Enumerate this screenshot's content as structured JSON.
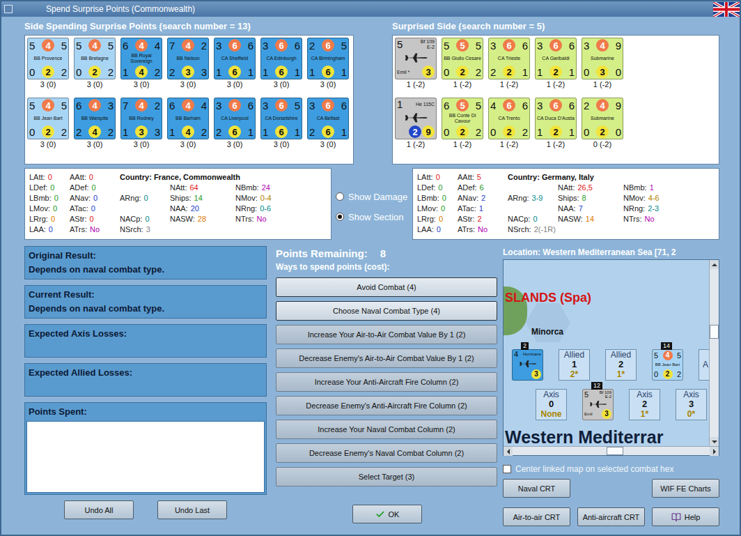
{
  "window": {
    "title": "Spend Surprise Points (Commonwealth)"
  },
  "spending_side": {
    "title": "Side Spending Surprise Points (search number = 13)",
    "rows": [
      [
        {
          "kind": "ship",
          "name": "BB Provence",
          "top": [
            "5",
            "4",
            "5"
          ],
          "bottom": [
            "0",
            "2",
            "2"
          ],
          "footer": "3 (0)",
          "color": "#a9d5f5"
        },
        {
          "kind": "ship",
          "name": "BB Bretagne",
          "top": [
            "5",
            "4",
            "5"
          ],
          "bottom": [
            "0",
            "2",
            "2"
          ],
          "footer": "3 (0)",
          "color": "#a9d5f5"
        },
        {
          "kind": "ship",
          "name": "BB Royal Sovereign",
          "top": [
            "6",
            "4",
            "4"
          ],
          "bottom": [
            "1",
            "4",
            "2"
          ],
          "footer": "3 (0)",
          "color": "#3d9de0"
        },
        {
          "kind": "ship",
          "name": "BB Nelson",
          "top": [
            "7",
            "4",
            "2"
          ],
          "bottom": [
            "2",
            "3",
            "3"
          ],
          "footer": "3 (0)",
          "color": "#3d9de0"
        },
        {
          "kind": "ship",
          "name": "CA Sheffield",
          "top": [
            "3",
            "6",
            "6"
          ],
          "bottom": [
            "1",
            "6",
            "1"
          ],
          "footer": "3 (0)",
          "color": "#3d9de0"
        },
        {
          "kind": "ship",
          "name": "CA Edinburgh",
          "top": [
            "3",
            "6",
            "6"
          ],
          "bottom": [
            "1",
            "6",
            "1"
          ],
          "footer": "3 (0)",
          "color": "#3d9de0"
        },
        {
          "kind": "ship",
          "name": "CA Birmingham",
          "top": [
            "2",
            "6",
            "5"
          ],
          "bottom": [
            "1",
            "6",
            "1"
          ],
          "footer": "3 (0)",
          "color": "#3d9de0"
        }
      ],
      [
        {
          "kind": "ship",
          "name": "BB Jean Bart",
          "top": [
            "5",
            "4",
            "5"
          ],
          "bottom": [
            "0",
            "2",
            "2"
          ],
          "footer": "3 (0)",
          "color": "#a9d5f5"
        },
        {
          "kind": "ship",
          "name": "BB Warspite",
          "top": [
            "6",
            "4",
            "3"
          ],
          "bottom": [
            "2",
            "4",
            "2"
          ],
          "footer": "3 (0)",
          "color": "#3d9de0"
        },
        {
          "kind": "ship",
          "name": "BB Rodney",
          "top": [
            "7",
            "4",
            "2"
          ],
          "bottom": [
            "1",
            "3",
            "3"
          ],
          "footer": "3 (0)",
          "color": "#3d9de0"
        },
        {
          "kind": "ship",
          "name": "BB Barham",
          "top": [
            "6",
            "4",
            "4"
          ],
          "bottom": [
            "1",
            "4",
            "2"
          ],
          "footer": "3 (0)",
          "color": "#3d9de0"
        },
        {
          "kind": "ship",
          "name": "CA Liverpool",
          "top": [
            "3",
            "6",
            "6"
          ],
          "bottom": [
            "2",
            "6",
            "1"
          ],
          "footer": "3 (0)",
          "color": "#3d9de0"
        },
        {
          "kind": "ship",
          "name": "CA Dorsetshire",
          "top": [
            "3",
            "6",
            "5"
          ],
          "bottom": [
            "1",
            "6",
            "1"
          ],
          "footer": "3 (0)",
          "color": "#3d9de0"
        },
        {
          "kind": "ship",
          "name": "CA Belfast",
          "top": [
            "3",
            "6",
            "6"
          ],
          "bottom": [
            "2",
            "6",
            "1"
          ],
          "footer": "3 (0)",
          "color": "#3d9de0"
        }
      ]
    ]
  },
  "surprised_side": {
    "title": "Surprised Side (search number = 5)",
    "rows": [
      [
        {
          "kind": "plane",
          "name": "Bf 109",
          "sub": "E-2",
          "value": "5",
          "nickname": "Emil",
          "mark": "*",
          "badges": [
            {
              "value": "3",
              "color": "#f2e43a"
            }
          ],
          "footer": "1 (-2)",
          "color": "#c6c6c6"
        },
        {
          "kind": "ship",
          "name": "BB Giulio Cesare",
          "top": [
            "5",
            "5",
            "5"
          ],
          "bottom": [
            "0",
            "2",
            "2"
          ],
          "footer": "1 (-2)",
          "color": "#d5ef88"
        },
        {
          "kind": "ship",
          "name": "CA Trieste",
          "top": [
            "3",
            "6",
            "6"
          ],
          "bottom": [
            "2",
            "2",
            "1"
          ],
          "footer": "1 (-2)",
          "color": "#d5ef88"
        },
        {
          "kind": "ship",
          "name": "CA Garibaldi",
          "top": [
            "3",
            "6",
            "6"
          ],
          "bottom": [
            "1",
            "2",
            "1"
          ],
          "footer": "1 (-2)",
          "color": "#d5ef88"
        },
        {
          "kind": "ship",
          "name": "Submarine",
          "top": [
            "3",
            "4",
            "9"
          ],
          "bottom": [
            "0",
            "3",
            "0"
          ],
          "footer": "1 (-2)",
          "color": "#d5ef88"
        }
      ],
      [
        {
          "kind": "plane",
          "name": "He 115C",
          "value": "1",
          "badges": [
            {
              "value": "2",
              "color": "#2346c8"
            },
            {
              "value": "9",
              "color": "#f2e43a"
            }
          ],
          "footer": "1 (-2)",
          "color": "#c6c6c6"
        },
        {
          "kind": "ship",
          "name": "BB Conte Di Cavour",
          "top": [
            "6",
            "5",
            "5"
          ],
          "bottom": [
            "0",
            "2",
            "2"
          ],
          "footer": "1 (-2)",
          "color": "#d5ef88"
        },
        {
          "kind": "ship",
          "name": "CA Trento",
          "top": [
            "4",
            "6",
            "6"
          ],
          "bottom": [
            "0",
            "2",
            "2"
          ],
          "footer": "1 (-2)",
          "color": "#d5ef88"
        },
        {
          "kind": "ship",
          "name": "CA Duca D'Aosta",
          "top": [
            "3",
            "6",
            "6"
          ],
          "bottom": [
            "1",
            "2",
            "1"
          ],
          "footer": "1 (-2)",
          "color": "#d5ef88"
        },
        {
          "kind": "ship",
          "name": "Submarine",
          "top": [
            "2",
            "4",
            "9"
          ],
          "bottom": [
            "0",
            "2",
            "0"
          ],
          "footer": "0 (-2)",
          "color": "#d5ef88"
        }
      ]
    ]
  },
  "stats_left": {
    "country_label": "Country:",
    "country": "France, Commonwealth",
    "rows": [
      [
        {
          "label": "LAtt:",
          "value": "0",
          "color": "#e01818"
        },
        {
          "label": "AAtt:",
          "value": "0",
          "color": "#e01818"
        }
      ],
      [
        {
          "label": "LDef:",
          "value": "0",
          "color": "#1e9a1e"
        },
        {
          "label": "ADef:",
          "value": "0",
          "color": "#1e9a1e"
        },
        null,
        {
          "label": "NAtt:",
          "value": "64",
          "color": "#e01818"
        },
        {
          "label": "NBmb:",
          "value": "24",
          "color": "#b000b0"
        }
      ],
      [
        {
          "label": "LBmb:",
          "value": "0",
          "color": "#1e9a1e"
        },
        {
          "label": "ANav:",
          "value": "0",
          "color": "#1a3ccc"
        },
        {
          "label": "ARng:",
          "value": "0",
          "color": "#008a8a"
        },
        {
          "label": "Ships:",
          "value": "14",
          "color": "#1e9a1e"
        },
        {
          "label": "NMov:",
          "value": "0-4",
          "color": "#b08000"
        }
      ],
      [
        {
          "label": "LMov:",
          "value": "0",
          "color": "#1e9a1e"
        },
        {
          "label": "ATac:",
          "value": "0",
          "color": "#1a3ccc"
        },
        null,
        {
          "label": "NAA:",
          "value": "20",
          "color": "#1a3ccc"
        },
        {
          "label": "NRng:",
          "value": "0-6",
          "color": "#008a8a"
        }
      ],
      [
        {
          "label": "LRrg:",
          "value": "0",
          "color": "#d87800"
        },
        {
          "label": "AStr:",
          "value": "0",
          "color": "#e01818"
        },
        {
          "label": "NACp:",
          "value": "0",
          "color": "#008a8a"
        },
        {
          "label": "NASW:",
          "value": "28",
          "color": "#d87800"
        },
        {
          "label": "NTrs:",
          "value": "No",
          "color": "#b000b0"
        }
      ],
      [
        {
          "label": "LAA:",
          "value": "0",
          "color": "#1a3ccc"
        },
        {
          "label": "ATrs:",
          "value": "No",
          "color": "#b000b0"
        },
        {
          "label": "NSrch:",
          "value": "3",
          "color": "#808080"
        },
        null,
        null
      ]
    ]
  },
  "stats_right": {
    "country_label": "Country:",
    "country": "Germany, Italy",
    "rows": [
      [
        {
          "label": "LAtt:",
          "value": "0",
          "color": "#e01818"
        },
        {
          "label": "AAtt:",
          "value": "5",
          "color": "#e01818"
        }
      ],
      [
        {
          "label": "LDef:",
          "value": "0",
          "color": "#1e9a1e"
        },
        {
          "label": "ADef:",
          "value": "6",
          "color": "#1e9a1e"
        },
        null,
        {
          "label": "NAtt:",
          "value": "26,5",
          "color": "#e01818"
        },
        {
          "label": "NBmb:",
          "value": "1",
          "color": "#b000b0"
        }
      ],
      [
        {
          "label": "LBmb:",
          "value": "0",
          "color": "#1e9a1e"
        },
        {
          "label": "ANav:",
          "value": "2",
          "color": "#1a3ccc"
        },
        {
          "label": "ARng:",
          "value": "3-9",
          "color": "#008a8a"
        },
        {
          "label": "Ships:",
          "value": "8",
          "color": "#1e9a1e"
        },
        {
          "label": "NMov:",
          "value": "4-6",
          "color": "#b08000"
        }
      ],
      [
        {
          "label": "LMov:",
          "value": "0",
          "color": "#1e9a1e"
        },
        {
          "label": "ATac:",
          "value": "1",
          "color": "#1a3ccc"
        },
        null,
        {
          "label": "NAA:",
          "value": "7",
          "color": "#1a3ccc"
        },
        {
          "label": "NRng:",
          "value": "2-3",
          "color": "#008a8a"
        }
      ],
      [
        {
          "label": "LRrg:",
          "value": "0",
          "color": "#d87800"
        },
        {
          "label": "AStr:",
          "value": "2",
          "color": "#e01818"
        },
        {
          "label": "NACp:",
          "value": "0",
          "color": "#008a8a"
        },
        {
          "label": "NASW:",
          "value": "14",
          "color": "#d87800"
        },
        {
          "label": "NTrs:",
          "value": "No",
          "color": "#b000b0"
        }
      ],
      [
        {
          "label": "LAA:",
          "value": "0",
          "color": "#1a3ccc"
        },
        {
          "label": "ATrs:",
          "value": "No",
          "color": "#b000b0"
        },
        {
          "label": "NSrch:",
          "value": "2(-1R)",
          "color": "#808080"
        },
        null,
        null
      ]
    ]
  },
  "view_options": [
    {
      "label": "Show Damage",
      "selected": false
    },
    {
      "label": "Show Section",
      "selected": true
    }
  ],
  "results": [
    {
      "label": "Original Result:",
      "value": "Depends on naval combat type."
    },
    {
      "label": "Current Result:",
      "value": "Depends on naval combat type."
    },
    {
      "label": "Expected Axis Losses:"
    },
    {
      "label": "Expected Allied Losses:"
    }
  ],
  "points_spent": {
    "label": "Points Spent:",
    "items": []
  },
  "undo_buttons": [
    "Undo All",
    "Undo Last"
  ],
  "points_remaining": {
    "label": "Points Remaining:",
    "value": "8"
  },
  "ways_label": "Ways to spend points (cost):",
  "actions": [
    {
      "label": "Avoid Combat (4)",
      "emphasized": true
    },
    {
      "label": "Choose Naval Combat Type (4)",
      "emphasized": true
    },
    {
      "label": "Increase Your Air-to-Air Combat Value By 1 (2)",
      "emphasized": false
    },
    {
      "label": "Decrease Enemy's Air-to-Air Combat Value By 1 (2)",
      "emphasized": false
    },
    {
      "label": "Increase Your Anti-Aircraft Fire Column (2)",
      "emphasized": false
    },
    {
      "label": "Decrease Enemy's Anti-Aircraft Fire Column (2)",
      "emphasized": false
    },
    {
      "label": "Increase Your Naval Combat Column (2)",
      "emphasized": false
    },
    {
      "label": "Decrease Enemy's Naval Combat Column (2)",
      "emphasized": false
    },
    {
      "label": "Select Target (3)",
      "emphasized": false
    }
  ],
  "ok_button": "OK",
  "location": {
    "label": "Location: Western Mediterranean Sea [71, 2"
  },
  "map": {
    "region_label": "SLANDS (Spa)",
    "island_label": "Minorca",
    "sea_label": "Western Mediterrar",
    "allied_row": [
      {
        "kind": "unit",
        "stack": "2",
        "unit": {
          "kind": "plane",
          "name": "Hurricane",
          "value": "4",
          "badges": [
            {
              "value": "3",
              "color": "#f2e43a"
            }
          ],
          "color": "#3d9de0"
        }
      },
      {
        "kind": "box",
        "side": "Allied",
        "count": "1",
        "value": "2*"
      },
      {
        "kind": "box",
        "side": "Allied",
        "count": "2",
        "value": "1*"
      },
      {
        "kind": "unit",
        "stack": "14",
        "unit": {
          "kind": "ship",
          "name": "BB Jean Bart",
          "top": [
            "5",
            "4",
            "5"
          ],
          "bottom": [
            "0",
            "2",
            "2"
          ],
          "color": "#a9d5f5"
        }
      },
      {
        "kind": "cut",
        "side": "A"
      }
    ],
    "axis_row": [
      {
        "kind": "box",
        "side": "Axis",
        "count": "0",
        "value": "None"
      },
      {
        "kind": "unit",
        "stack": "12",
        "unit": {
          "kind": "plane",
          "name": "Bf 109",
          "sub": "E-2",
          "value": "5",
          "nickname": "Emil",
          "badges": [
            {
              "value": "3",
              "color": "#f2e43a"
            }
          ],
          "color": "#c6c6c6"
        }
      },
      {
        "kind": "box",
        "side": "Axis",
        "count": "2",
        "value": "1*"
      },
      {
        "kind": "box",
        "side": "Axis",
        "count": "3",
        "value": "0*"
      }
    ]
  },
  "center_checkbox": {
    "label": "Center linked map on selected combat hex",
    "checked": false
  },
  "tool_buttons": [
    [
      {
        "label": "Naval CRT",
        "kind": "text"
      },
      {
        "label": "WIF FE Charts",
        "kind": "text"
      }
    ],
    [
      {
        "label": "Air-to-air CRT",
        "kind": "text"
      },
      {
        "label": "Anti-aircraft CRT",
        "kind": "text"
      },
      {
        "label": "Help",
        "kind": "help"
      }
    ]
  ]
}
